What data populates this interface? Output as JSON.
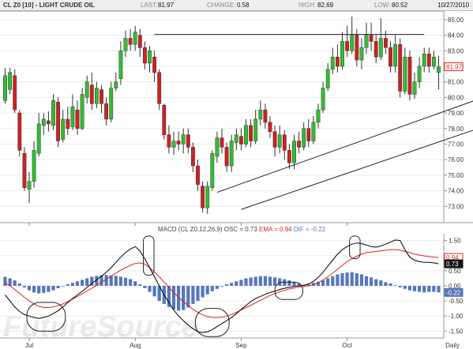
{
  "header": {
    "symbol": "CL Z0 [10] - LIGHT CRUDE OIL",
    "last_label": "LAST:",
    "last": "81.97",
    "change_label": "CHANGE:",
    "change": "0.58",
    "high_label": "HIGH:",
    "high": "82.69",
    "low_label": "LOW:",
    "low": "80.52",
    "date": "10/27/2010"
  },
  "macd_header": {
    "prefix": "MACD (CL Z0,12,26,9)",
    "osc_label": "OSC = ",
    "osc": "0.73",
    "ema_label": "EMA = ",
    "ema": "0.94",
    "dif_label": "DIF = ",
    "dif": "-0.22"
  },
  "watermark": "FutureSource",
  "colors": {
    "up": "#33bb33",
    "down": "#cc2222",
    "histogram": "#5577bb",
    "macd_line": "#000000",
    "signal_line": "#dd2222",
    "last_price_tag": "#dd2222"
  },
  "chart_data": [
    {
      "type": "candlestick",
      "ylim": [
        72,
        85.5
      ],
      "y_ticks": [
        "85.00",
        "84.00",
        "83.00",
        "82.00",
        "81.00",
        "80.00",
        "79.00",
        "78.00",
        "77.00",
        "76.00",
        "75.00",
        "74.00",
        "73.00"
      ],
      "x_tick_labels": [
        "Jul",
        "Aug",
        "Sep",
        "Oct",
        "Daily"
      ],
      "x_tick_index": [
        5,
        27,
        49,
        71,
        91
      ],
      "last_price_tag": "81.97",
      "candles": [
        [
          79.8,
          81.4,
          81.9,
          79.6
        ],
        [
          80.5,
          81.6,
          81.9,
          80.2
        ],
        [
          81.4,
          79.2,
          81.8,
          79.0
        ],
        [
          79.0,
          76.6,
          79.2,
          76.2
        ],
        [
          76.4,
          74.2,
          76.8,
          74.0
        ],
        [
          74.1,
          74.6,
          75.2,
          73.2
        ],
        [
          74.6,
          76.6,
          77.2,
          74.2
        ],
        [
          76.4,
          78.3,
          79.0,
          76.2
        ],
        [
          78.2,
          78.6,
          79.0,
          77.6
        ],
        [
          78.5,
          78.3,
          79.1,
          77.8
        ],
        [
          78.2,
          79.8,
          80.2,
          77.9
        ],
        [
          79.7,
          77.2,
          80.0,
          76.8
        ],
        [
          77.3,
          78.6,
          79.2,
          77.1
        ],
        [
          78.6,
          78.0,
          79.4,
          77.6
        ],
        [
          78.1,
          79.4,
          80.2,
          77.9
        ],
        [
          79.2,
          78.0,
          79.8,
          77.6
        ],
        [
          78.0,
          80.2,
          80.6,
          77.9
        ],
        [
          80.0,
          81.0,
          81.4,
          79.6
        ],
        [
          80.8,
          79.6,
          81.6,
          79.2
        ],
        [
          79.6,
          80.6,
          81.0,
          79.3
        ],
        [
          80.5,
          79.6,
          80.8,
          79.0
        ],
        [
          79.6,
          78.6,
          80.0,
          78.2
        ],
        [
          78.6,
          80.6,
          81.0,
          78.4
        ],
        [
          80.6,
          81.0,
          81.6,
          80.4
        ],
        [
          81.2,
          83.0,
          83.6,
          80.8
        ],
        [
          83.0,
          83.8,
          84.3,
          82.6
        ],
        [
          83.8,
          83.4,
          84.4,
          83.0
        ],
        [
          83.4,
          84.2,
          84.6,
          83.0
        ],
        [
          84.0,
          83.2,
          84.4,
          82.6
        ],
        [
          83.2,
          82.2,
          83.6,
          81.8
        ],
        [
          82.2,
          83.0,
          83.3,
          81.6
        ],
        [
          82.6,
          81.6,
          83.0,
          81.0
        ],
        [
          81.6,
          79.6,
          81.8,
          79.2
        ],
        [
          79.5,
          77.6,
          79.6,
          77.3
        ],
        [
          77.6,
          76.8,
          78.2,
          76.4
        ],
        [
          76.8,
          77.2,
          77.8,
          76.3
        ],
        [
          77.2,
          77.0,
          77.8,
          76.6
        ],
        [
          77.0,
          77.6,
          78.0,
          76.4
        ],
        [
          77.6,
          76.8,
          78.0,
          76.4
        ],
        [
          76.8,
          75.6,
          77.1,
          75.2
        ],
        [
          75.6,
          74.4,
          76.0,
          74.0
        ],
        [
          74.3,
          72.9,
          74.6,
          72.6
        ],
        [
          72.9,
          74.3,
          74.6,
          72.5
        ],
        [
          74.2,
          76.4,
          76.6,
          74.0
        ],
        [
          76.2,
          77.4,
          77.8,
          75.8
        ],
        [
          77.4,
          76.8,
          78.0,
          76.4
        ],
        [
          76.8,
          75.6,
          77.1,
          75.2
        ],
        [
          75.6,
          77.2,
          77.6,
          75.2
        ],
        [
          77.1,
          77.6,
          78.0,
          76.6
        ],
        [
          77.5,
          77.0,
          78.0,
          76.6
        ],
        [
          77.0,
          78.2,
          78.6,
          76.8
        ],
        [
          78.2,
          77.2,
          78.6,
          76.8
        ],
        [
          77.2,
          78.6,
          79.2,
          77.0
        ],
        [
          78.6,
          79.2,
          79.8,
          78.2
        ],
        [
          79.2,
          78.4,
          79.6,
          78.0
        ],
        [
          78.4,
          77.8,
          78.8,
          77.4
        ],
        [
          77.8,
          76.8,
          78.2,
          76.2
        ],
        [
          76.8,
          77.6,
          78.2,
          76.4
        ],
        [
          77.6,
          76.6,
          77.9,
          76.0
        ],
        [
          76.6,
          75.8,
          77.0,
          75.4
        ],
        [
          75.8,
          77.2,
          77.6,
          75.4
        ],
        [
          77.2,
          76.8,
          77.8,
          76.4
        ],
        [
          76.8,
          78.0,
          78.4,
          76.6
        ],
        [
          78.0,
          77.2,
          78.6,
          76.8
        ],
        [
          77.2,
          78.4,
          78.8,
          77.0
        ],
        [
          78.4,
          79.2,
          79.6,
          78.0
        ],
        [
          79.2,
          80.6,
          81.0,
          79.0
        ],
        [
          80.6,
          81.8,
          82.2,
          80.4
        ],
        [
          81.8,
          82.6,
          83.2,
          81.5
        ],
        [
          82.6,
          82.0,
          83.4,
          81.6
        ],
        [
          82.0,
          83.6,
          84.2,
          81.8
        ],
        [
          83.6,
          83.0,
          84.6,
          82.6
        ],
        [
          83.0,
          84.0,
          85.2,
          82.8
        ],
        [
          84.0,
          82.4,
          84.4,
          82.0
        ],
        [
          82.4,
          83.2,
          83.8,
          81.8
        ],
        [
          83.2,
          84.0,
          84.8,
          82.8
        ],
        [
          84.0,
          83.6,
          84.8,
          83.0
        ],
        [
          83.6,
          82.6,
          84.0,
          82.2
        ],
        [
          82.6,
          83.8,
          85.1,
          82.4
        ],
        [
          83.8,
          83.2,
          84.3,
          82.8
        ],
        [
          83.2,
          82.0,
          83.6,
          81.6
        ],
        [
          82.0,
          83.4,
          84.0,
          81.6
        ],
        [
          83.4,
          80.4,
          83.8,
          80.0
        ],
        [
          80.4,
          82.6,
          83.2,
          80.2
        ],
        [
          82.6,
          80.2,
          83.0,
          79.8
        ],
        [
          80.2,
          81.0,
          81.6,
          79.9
        ],
        [
          81.0,
          82.0,
          82.6,
          80.6
        ],
        [
          82.0,
          82.8,
          83.2,
          81.6
        ],
        [
          82.8,
          82.0,
          83.2,
          81.6
        ],
        [
          82.0,
          82.6,
          83.0,
          81.8
        ],
        [
          81.6,
          81.97,
          82.69,
          80.52
        ]
      ],
      "trendlines": [
        {
          "from": [
            31,
            84.05
          ],
          "to": [
            87,
            84.05
          ]
        },
        {
          "from": [
            49,
            72.8
          ],
          "to": [
            102,
            78.4
          ]
        },
        {
          "from": [
            44,
            73.9
          ],
          "to": [
            102,
            80.3
          ]
        },
        {
          "from": [
            101,
            79.95
          ],
          "to": [
            102,
            80.3
          ]
        }
      ]
    },
    {
      "type": "macd",
      "ylim": [
        -1.7,
        1.7
      ],
      "y_ticks": [
        "1.50",
        "1.00",
        "0.50",
        "0.00",
        "-0.50",
        "-1.00",
        "-1.50"
      ],
      "tags": {
        "osc": "0.94",
        "ema": "0.73",
        "dif": "-0.22"
      },
      "histogram": [
        0.3,
        0.25,
        0.18,
        0.08,
        -0.05,
        -0.15,
        -0.22,
        -0.25,
        -0.24,
        -0.2,
        -0.15,
        -0.08,
        -0.02,
        0.05,
        0.1,
        0.15,
        0.2,
        0.25,
        0.3,
        0.33,
        0.35,
        0.36,
        0.35,
        0.33,
        0.3,
        0.27,
        0.22,
        0.15,
        0.05,
        -0.08,
        -0.2,
        -0.35,
        -0.5,
        -0.6,
        -0.7,
        -0.78,
        -0.82,
        -0.8,
        -0.72,
        -0.6,
        -0.5,
        -0.38,
        -0.28,
        -0.18,
        -0.1,
        -0.02,
        0.05,
        0.1,
        0.15,
        0.2,
        0.25,
        0.28,
        0.3,
        0.32,
        0.32,
        0.3,
        0.28,
        0.25,
        0.22,
        0.18,
        0.12,
        0.08,
        0.02,
        0.05,
        0.1,
        0.14,
        0.18,
        0.25,
        0.32,
        0.38,
        0.42,
        0.44,
        0.45,
        0.42,
        0.38,
        0.32,
        0.28,
        0.22,
        0.18,
        0.12,
        0.08,
        0.02,
        -0.05,
        -0.1,
        -0.15,
        -0.18,
        -0.2,
        -0.22,
        -0.2,
        -0.2,
        -0.22
      ],
      "macd_line": [
        -0.3,
        -0.5,
        -0.7,
        -0.85,
        -0.95,
        -1.0,
        -1.05,
        -1.08,
        -1.05,
        -1.0,
        -0.92,
        -0.82,
        -0.7,
        -0.55,
        -0.42,
        -0.3,
        -0.18,
        -0.05,
        0.08,
        0.2,
        0.32,
        0.45,
        0.6,
        0.78,
        0.95,
        1.1,
        1.22,
        1.3,
        1.15,
        0.9,
        0.6,
        0.3,
        0.0,
        -0.3,
        -0.55,
        -0.8,
        -1.0,
        -1.15,
        -1.3,
        -1.42,
        -1.52,
        -1.55,
        -1.52,
        -1.45,
        -1.35,
        -1.25,
        -1.15,
        -1.05,
        -0.92,
        -0.78,
        -0.65,
        -0.52,
        -0.42,
        -0.35,
        -0.28,
        -0.22,
        -0.18,
        -0.12,
        -0.08,
        -0.05,
        -0.02,
        0.0,
        0.02,
        0.06,
        0.15,
        0.28,
        0.45,
        0.65,
        0.85,
        1.05,
        1.2,
        1.3,
        1.38,
        1.42,
        1.4,
        1.35,
        1.3,
        1.28,
        1.32,
        1.38,
        1.45,
        1.52,
        1.5,
        1.2,
        0.95,
        0.85,
        0.8,
        0.78,
        0.78,
        0.76,
        0.73
      ],
      "signal_line": [
        0.1,
        0.0,
        -0.12,
        -0.25,
        -0.38,
        -0.5,
        -0.6,
        -0.68,
        -0.72,
        -0.72,
        -0.7,
        -0.66,
        -0.6,
        -0.52,
        -0.44,
        -0.35,
        -0.26,
        -0.17,
        -0.08,
        0.02,
        0.12,
        0.22,
        0.32,
        0.42,
        0.52,
        0.6,
        0.68,
        0.74,
        0.76,
        0.72,
        0.6,
        0.45,
        0.3,
        0.12,
        -0.05,
        -0.22,
        -0.38,
        -0.52,
        -0.65,
        -0.78,
        -0.88,
        -0.96,
        -1.02,
        -1.05,
        -1.05,
        -1.04,
        -1.0,
        -0.95,
        -0.88,
        -0.8,
        -0.72,
        -0.64,
        -0.56,
        -0.48,
        -0.4,
        -0.32,
        -0.26,
        -0.2,
        -0.15,
        -0.1,
        -0.07,
        -0.04,
        -0.02,
        0.0,
        0.04,
        0.1,
        0.2,
        0.3,
        0.42,
        0.55,
        0.68,
        0.8,
        0.9,
        0.98,
        1.05,
        1.1,
        1.12,
        1.14,
        1.16,
        1.18,
        1.2,
        1.2,
        1.18,
        1.14,
        1.1,
        1.05,
        1.02,
        0.99,
        0.97,
        0.95,
        0.94
      ],
      "annotation_ellipses": [
        {
          "x0": 4.5,
          "x1": 12.5,
          "y0": -0.55,
          "y1": -1.5
        },
        {
          "x0": 28.7,
          "x1": 30.9,
          "y0": 1.65,
          "y1": 0.35
        },
        {
          "x0": 39.5,
          "x1": 46.5,
          "y0": -0.75,
          "y1": -1.68
        },
        {
          "x0": 56.0,
          "x1": 61.8,
          "y0": 0.12,
          "y1": -0.45
        },
        {
          "x0": 71.5,
          "x1": 73.7,
          "y0": 1.65,
          "y1": 0.9
        }
      ]
    }
  ]
}
